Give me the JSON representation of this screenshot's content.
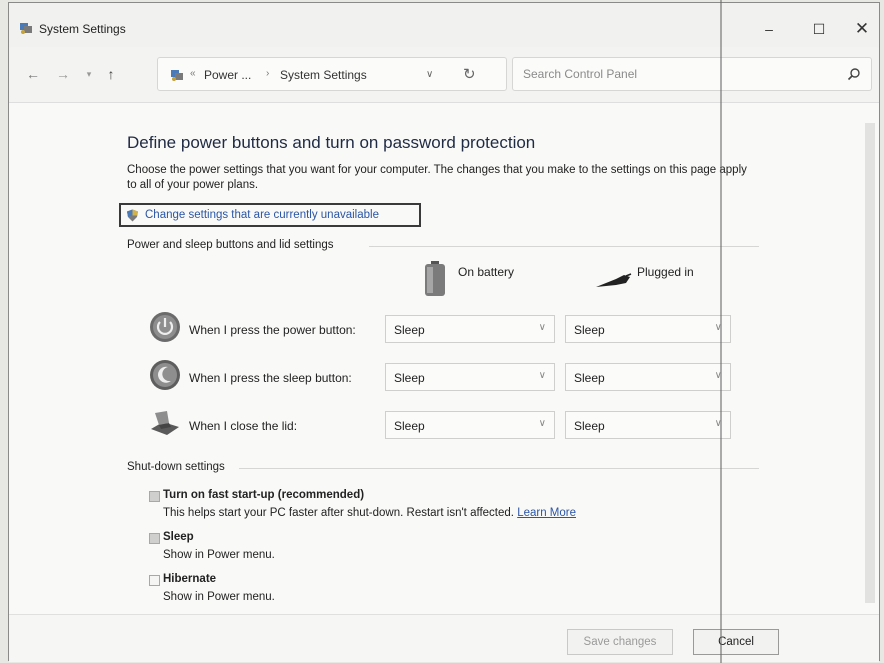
{
  "window": {
    "title": "System Settings",
    "controls": {
      "minimize": "–",
      "maximize": "☐",
      "close": "✕"
    }
  },
  "nav": {
    "back": "←",
    "forward": "→",
    "recent": "▾",
    "up": "↑",
    "address": {
      "crumbs": [
        "Power ...",
        "System Settings"
      ],
      "separator": "›",
      "dropdown": "∨",
      "refresh": "↻"
    },
    "search": {
      "placeholder": "Search Control Panel",
      "value": ""
    }
  },
  "main": {
    "heading": "Define power buttons and turn on password protection",
    "description": "Choose the power settings that you want for your computer. The changes that you make to the settings on this page apply to all of your power plans.",
    "uac_link": "Change settings that are currently unavailable",
    "buttons_section": {
      "title": "Power and sleep buttons and lid settings",
      "columns": [
        "On battery",
        "Plugged in"
      ],
      "rows": [
        {
          "label": "When I press the power button:",
          "battery": "Sleep",
          "plugged": "Sleep",
          "icon": "power-button-icon"
        },
        {
          "label": "When I press the sleep button:",
          "battery": "Sleep",
          "plugged": "Sleep",
          "icon": "sleep-button-icon"
        },
        {
          "label": "When I close the lid:",
          "battery": "Sleep",
          "plugged": "Sleep",
          "icon": "laptop-lid-icon"
        }
      ]
    },
    "shutdown_section": {
      "title": "Shut-down settings",
      "options": [
        {
          "label": "Turn on fast start-up (recommended)",
          "desc": "This helps start your PC faster after shut-down. Restart isn't affected.",
          "link": "Learn More",
          "checked": true
        },
        {
          "label": "Sleep",
          "desc": "Show in Power menu.",
          "checked": true
        },
        {
          "label": "Hibernate",
          "desc": "Show in Power menu.",
          "checked": false
        }
      ]
    }
  },
  "footer": {
    "save": "Save changes",
    "cancel": "Cancel"
  },
  "colors": {
    "link": "#2b55a6",
    "heading": "#1f2a44",
    "background": "#f9f9f7"
  }
}
